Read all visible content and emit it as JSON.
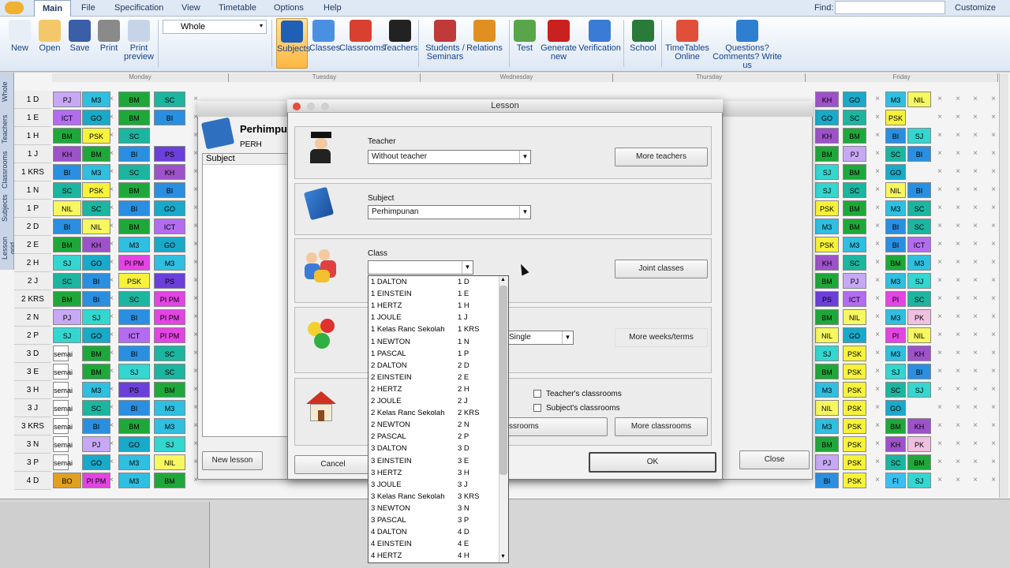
{
  "menubar": {
    "tabs": [
      "Main",
      "File",
      "Specification",
      "View",
      "Timetable",
      "Options",
      "Help"
    ],
    "find_label": "Find:",
    "customize": "Customize"
  },
  "ribbon": {
    "buttons": [
      {
        "label": "New",
        "icon": "new-file-icon"
      },
      {
        "label": "Open",
        "icon": "open-folder-icon"
      },
      {
        "label": "Save",
        "icon": "save-icon"
      },
      {
        "label": "Print",
        "icon": "printer-icon"
      },
      {
        "label": "Print preview",
        "icon": "print-preview-icon"
      },
      {
        "label": "Subjects",
        "icon": "subjects-book-icon"
      },
      {
        "label": "Classes",
        "icon": "classes-people-icon"
      },
      {
        "label": "Classrooms",
        "icon": "classroom-house-icon"
      },
      {
        "label": "Teachers",
        "icon": "teacher-icon"
      },
      {
        "label": "Students / Seminars",
        "icon": "students-icon"
      },
      {
        "label": "Relations",
        "icon": "relations-icon"
      },
      {
        "label": "Test",
        "icon": "test-icon"
      },
      {
        "label": "Generate new",
        "icon": "generate-icon"
      },
      {
        "label": "Verification",
        "icon": "verification-icon"
      },
      {
        "label": "School",
        "icon": "school-board-icon"
      },
      {
        "label": "TimeTables Online",
        "icon": "timetables-online-icon"
      },
      {
        "label": "Questions? Comments? Write us",
        "icon": "help-question-icon"
      }
    ],
    "view_select": "Whole"
  },
  "vtabs": [
    "Whole",
    "Teachers",
    "Classrooms",
    "Subjects",
    "Lesson grid"
  ],
  "days": [
    "Monday",
    "Tuesday",
    "Wednesday",
    "Thursday",
    "Friday"
  ],
  "classes": [
    "1 D",
    "1 E",
    "1 H",
    "1 J",
    "1 KRS",
    "1 N",
    "1 P",
    "2 D",
    "2 E",
    "2 H",
    "2 J",
    "2 KRS",
    "2 N",
    "2 P",
    "3 D",
    "3 E",
    "3 H",
    "3 J",
    "3 KRS",
    "3 N",
    "3 P",
    "4 D"
  ],
  "grid_monday": [
    [
      "PJ",
      "M3",
      "BM",
      "SC"
    ],
    [
      "ICT",
      "GO",
      "BM",
      "BI"
    ],
    [
      "BM",
      "PSK",
      "SC"
    ],
    [
      "KH",
      "BM",
      "BI",
      "PS"
    ],
    [
      "BI",
      "M3",
      "SC",
      "KH"
    ],
    [
      "SC",
      "PSK",
      "BM",
      "BI"
    ],
    [
      "NIL",
      "SC",
      "BI",
      "GO"
    ],
    [
      "BI",
      "NIL",
      "BM",
      "ICT"
    ],
    [
      "BM",
      "KH",
      "M3",
      "GO"
    ],
    [
      "SJ",
      "GO",
      "PI PM",
      "M3"
    ],
    [
      "SC",
      "BI",
      "PSK",
      "PS"
    ],
    [
      "BM",
      "BI",
      "SC",
      "PI PM"
    ],
    [
      "PJ",
      "SJ",
      "BI",
      "PI PM"
    ],
    [
      "SJ",
      "GO",
      "ICT",
      "PI PM"
    ],
    [
      "semai",
      "BM",
      "BI",
      "SC"
    ],
    [
      "semai",
      "BM",
      "SJ",
      "SC"
    ],
    [
      "semai",
      "M3",
      "PS",
      "BM"
    ],
    [
      "semai",
      "SC",
      "BI",
      "M3"
    ],
    [
      "semai",
      "BI",
      "BM",
      "M3"
    ],
    [
      "semai",
      "PJ",
      "GO",
      "SJ"
    ],
    [
      "semai",
      "GO",
      "M3",
      "NIL"
    ],
    [
      "BO",
      "PI PM",
      "M3",
      "BM"
    ]
  ],
  "grid_friday": [
    [
      "KH",
      "GO",
      "M3",
      "NIL"
    ],
    [
      "GO",
      "SC",
      "PSK"
    ],
    [
      "KH",
      "BM",
      "BI",
      "SJ"
    ],
    [
      "BM",
      "PJ",
      "SC",
      "BI"
    ],
    [
      "SJ",
      "BM",
      "GO"
    ],
    [
      "SJ",
      "SC",
      "NIL",
      "BI"
    ],
    [
      "PSK",
      "BM",
      "M3",
      "SC"
    ],
    [
      "M3",
      "BM",
      "BI",
      "SC"
    ],
    [
      "PSK",
      "M3",
      "BI",
      "ICT"
    ],
    [
      "KH",
      "SC",
      "BM",
      "M3"
    ],
    [
      "BM",
      "PJ",
      "M3",
      "SJ"
    ],
    [
      "PS",
      "ICT",
      "PI PM",
      "SC"
    ],
    [
      "BM",
      "NIL",
      "M3",
      "PK"
    ],
    [
      "NIL",
      "GO",
      "PI PM",
      "NIL"
    ],
    [
      "SJ",
      "PSK",
      "M3",
      "KH"
    ],
    [
      "BM",
      "PSK",
      "SJ",
      "BI"
    ],
    [
      "M3",
      "PSK",
      "SC",
      "SJ"
    ],
    [
      "NIL",
      "PSK",
      "GO"
    ],
    [
      "M3",
      "PSK",
      "BM",
      "KH"
    ],
    [
      "BM",
      "PSK",
      "KH",
      "PK"
    ],
    [
      "PJ",
      "PSK",
      "SC",
      "BM"
    ],
    [
      "BI",
      "PSK",
      "FI",
      "SJ"
    ]
  ],
  "bg_dialog": {
    "title": "Perhimpun",
    "subtitle": "PERH",
    "list_header": "Subject",
    "new_lesson": "New lesson",
    "close": "Close"
  },
  "dialog": {
    "title": "Lesson",
    "teacher_label": "Teacher",
    "teacher_value": "Without teacher",
    "more_teachers": "More teachers",
    "subject_label": "Subject",
    "subject_value": "Perhimpunan",
    "class_label": "Class",
    "class_value": "",
    "joint_classes": "Joint classes",
    "weeks_value": "Single",
    "more_weeks": "More weeks/terms",
    "teachers_classrooms": "Teacher's classrooms",
    "subjects_classrooms": "Subject's classrooms",
    "classrooms_btn": "ssrooms",
    "more_classrooms": "More classrooms",
    "cancel": "Cancel",
    "ok": "OK"
  },
  "dropdown": [
    [
      "1 DALTON",
      "1 D"
    ],
    [
      "1 EINSTEIN",
      "1 E"
    ],
    [
      "1 HERTZ",
      "1 H"
    ],
    [
      "1 JOULE",
      "1 J"
    ],
    [
      "1 Kelas Ranc Sekolah",
      "1 KRS"
    ],
    [
      "1 NEWTON",
      "1 N"
    ],
    [
      "1 PASCAL",
      "1 P"
    ],
    [
      "2 DALTON",
      "2 D"
    ],
    [
      "2 EINSTEIN",
      "2 E"
    ],
    [
      "2 HERTZ",
      "2 H"
    ],
    [
      "2 JOULE",
      "2 J"
    ],
    [
      "2 Kelas Ranc Sekolah",
      "2 KRS"
    ],
    [
      "2 NEWTON",
      "2 N"
    ],
    [
      "2 PASCAL",
      "2 P"
    ],
    [
      "3 DALTON",
      "3 D"
    ],
    [
      "3 EINSTEIN",
      "3 E"
    ],
    [
      "3 HERTZ",
      "3 H"
    ],
    [
      "3 JOULE",
      "3 J"
    ],
    [
      "3 Kelas Ranc Sekolah",
      "3 KRS"
    ],
    [
      "3 NEWTON",
      "3 N"
    ],
    [
      "3 PASCAL",
      "3 P"
    ],
    [
      "4 DALTON",
      "4 D"
    ],
    [
      "4 EINSTEIN",
      "4 E"
    ],
    [
      "4 HERTZ",
      "4 H"
    ]
  ],
  "colors": {
    "BM": "#1fa83a",
    "SC": "#1bb5a0",
    "BI": "#2a8fe0",
    "M3": "#2fbfe0",
    "PJ": "#c7a8f5",
    "ICT": "#b36cf0",
    "GO": "#19a9c9",
    "KH": "#9d52c9",
    "PSK": "#f7f23a",
    "NIL": "#f7f760",
    "PS": "#6b3fd9",
    "PI PM": "#e344e3",
    "SJ": "#34d6d0",
    "semai": "#ffffff",
    "BO": "#e0a020",
    "PK": "#f0c0e0",
    "FI": "#3ac0f0"
  }
}
